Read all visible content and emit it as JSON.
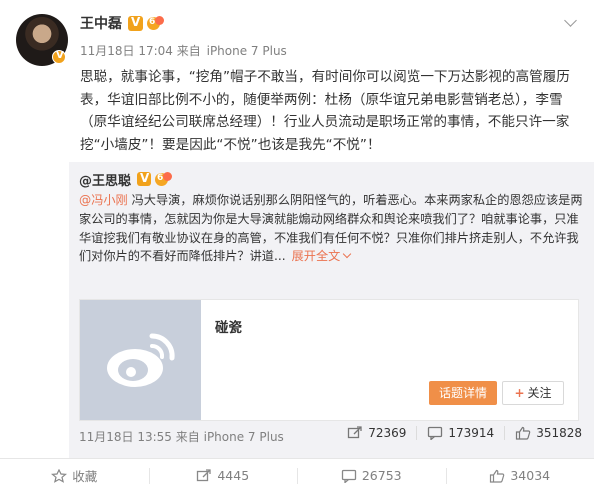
{
  "post": {
    "username": "王中磊",
    "time": "11月18日 17:04",
    "source_prefix": "来自",
    "source": "iPhone 7 Plus",
    "text": "思聪，就事论事，“挖角”帽子不敢当，有时间你可以阅览一下万达影视的高管履历表，华谊旧部比例不小的，随便举两例：杜杨（原华谊兄弟电影营销老总），李雪（原华谊经纪公司联席总经理）！行业人员流动是职场正常的事情，不能只许一家挖“小墙皮”！要是因此“不悦”也该是我先“不悦”！"
  },
  "retweet": {
    "username": "@王思聪",
    "mention": "@冯小刚",
    "text": " 冯大导演，麻烦你说话别那么阴阳怪气的，听着恶心。本来两家私企的恩怨应该是两家公司的事情，怎就因为你是大导演就能煽动网络群众和舆论来喷我们了？咱就事论事，只准华谊挖我们有敬业协议在身的高管，不准我们有任何不悦？只准你们排片挤走别人，不允许我们对你片的不看好而降低排片？讲道...",
    "expand_label": "展开全文",
    "card": {
      "title": "碰瓷",
      "topic_button": "话题详情",
      "follow_button": "关注"
    },
    "time": "11月18日 13:55",
    "source_prefix": "来自",
    "source": "iPhone 7 Plus",
    "reposts": "72369",
    "comments": "173914",
    "likes": "351828"
  },
  "actions": {
    "favorite": "收藏",
    "repost": "4445",
    "comment": "26753",
    "like": "34034"
  },
  "colors": {
    "accent": "#eb7350",
    "topic_button": "#f08f48",
    "verified": "#f1a21c",
    "retweet_bg": "#f2f2f5"
  },
  "icons": [
    "avatar",
    "verified-badge-icon",
    "vip-badge-icon",
    "chevron-down-icon",
    "weibo-logo-icon",
    "repost-icon",
    "comment-icon",
    "like-icon",
    "favorite-icon"
  ]
}
